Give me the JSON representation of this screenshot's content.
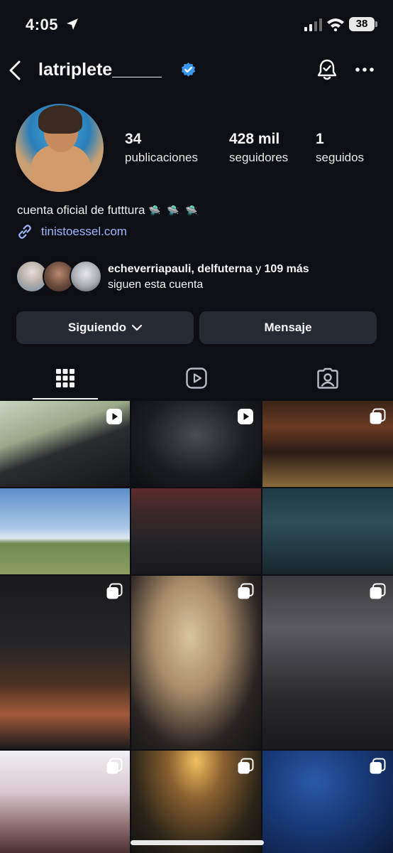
{
  "status_bar": {
    "time": "4:05",
    "battery": "38"
  },
  "header": {
    "username": "latriplete_____"
  },
  "stats": [
    {
      "value": "34",
      "label": "publicaciones"
    },
    {
      "value": "428 mil",
      "label": "seguidores"
    },
    {
      "value": "1",
      "label": "seguidos"
    }
  ],
  "bio": {
    "text": "cuenta oficial de futttura",
    "emoji": "🛸 🛸 🛸",
    "link": "tinistoessel.com"
  },
  "mutual": {
    "names": "echeverriapauli, delfuterna",
    "connector": " y ",
    "more": "109 más",
    "suffix": "siguen esta cuenta"
  },
  "buttons": {
    "following": "Siguiendo",
    "message": "Mensaje"
  },
  "tabs": {
    "active": "posts-grid"
  },
  "grid": {
    "tiles": [
      {
        "type": "reel"
      },
      {
        "type": "reel"
      },
      {
        "type": "carousel"
      },
      {
        "type": "photo"
      },
      {
        "type": "photo"
      },
      {
        "type": "photo"
      },
      {
        "type": "carousel"
      },
      {
        "type": "carousel"
      },
      {
        "type": "carousel"
      },
      {
        "type": "carousel"
      },
      {
        "type": "carousel"
      },
      {
        "type": "carousel"
      }
    ]
  },
  "colors": {
    "background": "#0d0f14",
    "button": "#262a33",
    "link": "#9fb6ff",
    "verified": "#3897f0"
  }
}
